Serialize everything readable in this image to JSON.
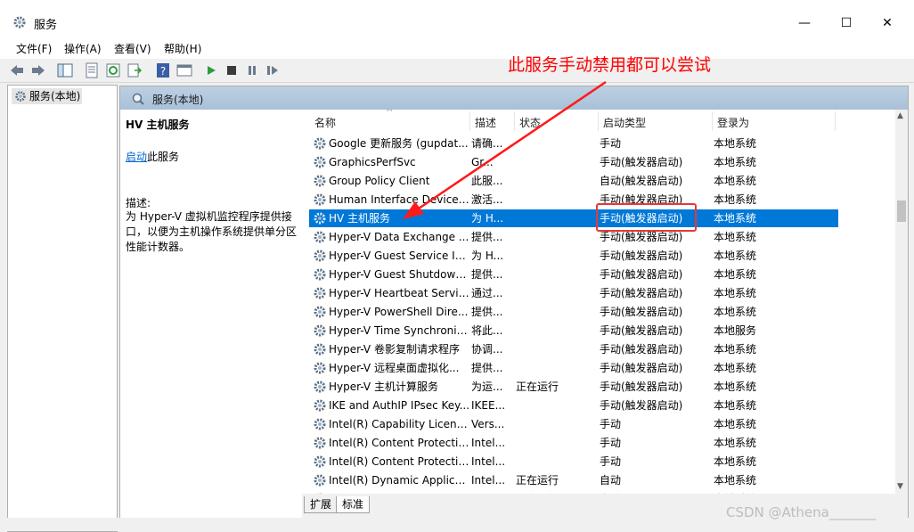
{
  "window": {
    "title": "服务",
    "min": "—",
    "max": "☐",
    "close": "✕"
  },
  "menu": [
    "文件(F)",
    "操作(A)",
    "查看(V)",
    "帮助(H)"
  ],
  "tree": {
    "item": "服务(本地)"
  },
  "main_header": "服务(本地)",
  "detail": {
    "service_name": "HV 主机服务",
    "start_link": "启动",
    "start_suffix": "此服务",
    "desc_label": "描述:",
    "desc_text": "为 Hyper-V 虚拟机监控程序提供接口，以便为主机操作系统提供单分区性能计数器。"
  },
  "columns": {
    "name": "名称",
    "desc": "描述",
    "status": "状态",
    "start_type": "启动类型",
    "logon": "登录为",
    "sort_arrow": "^"
  },
  "rows": [
    {
      "name": "Google 更新服务 (gupdat...",
      "desc": "请确...",
      "status": "",
      "start": "手动",
      "logon": "本地系统"
    },
    {
      "name": "GraphicsPerfSvc",
      "desc": "Gr...",
      "status": "",
      "start": "手动(触发器启动)",
      "logon": "本地系统"
    },
    {
      "name": "Group Policy Client",
      "desc": "此服...",
      "status": "",
      "start": "自动(触发器启动)",
      "logon": "本地系统"
    },
    {
      "name": "Human Interface Device ...",
      "desc": "激活...",
      "status": "",
      "start": "手动(触发器启动)",
      "logon": "本地系统"
    },
    {
      "name": "HV 主机服务",
      "desc": "为 H...",
      "status": "",
      "start": "手动(触发器启动)",
      "logon": "本地系统"
    },
    {
      "name": "Hyper-V Data Exchange ...",
      "desc": "提供...",
      "status": "",
      "start": "手动(触发器启动)",
      "logon": "本地系统"
    },
    {
      "name": "Hyper-V Guest Service In...",
      "desc": "为 H...",
      "status": "",
      "start": "手动(触发器启动)",
      "logon": "本地系统"
    },
    {
      "name": "Hyper-V Guest Shutdown...",
      "desc": "提供...",
      "status": "",
      "start": "手动(触发器启动)",
      "logon": "本地系统"
    },
    {
      "name": "Hyper-V Heartbeat Service",
      "desc": "通过...",
      "status": "",
      "start": "手动(触发器启动)",
      "logon": "本地系统"
    },
    {
      "name": "Hyper-V PowerShell Dire...",
      "desc": "提供...",
      "status": "",
      "start": "手动(触发器启动)",
      "logon": "本地系统"
    },
    {
      "name": "Hyper-V Time Synchroniz...",
      "desc": "将此...",
      "status": "",
      "start": "手动(触发器启动)",
      "logon": "本地服务"
    },
    {
      "name": "Hyper-V 卷影复制请求程序",
      "desc": "协调...",
      "status": "",
      "start": "手动(触发器启动)",
      "logon": "本地系统"
    },
    {
      "name": "Hyper-V 远程桌面虚拟化...",
      "desc": "提供...",
      "status": "",
      "start": "手动(触发器启动)",
      "logon": "本地系统"
    },
    {
      "name": "Hyper-V 主机计算服务",
      "desc": "为运...",
      "status": "正在运行",
      "start": "手动(触发器启动)",
      "logon": "本地系统"
    },
    {
      "name": "IKE and AuthIP IPsec Key...",
      "desc": "IKEE...",
      "status": "",
      "start": "手动(触发器启动)",
      "logon": "本地系统"
    },
    {
      "name": "Intel(R) Capability Licensi...",
      "desc": "Vers...",
      "status": "",
      "start": "手动",
      "logon": "本地系统"
    },
    {
      "name": "Intel(R) Content Protectio...",
      "desc": "Intel...",
      "status": "",
      "start": "手动",
      "logon": "本地系统"
    },
    {
      "name": "Intel(R) Content Protectio...",
      "desc": "Intel...",
      "status": "",
      "start": "手动",
      "logon": "本地系统"
    },
    {
      "name": "Intel(R) Dynamic Applicat...",
      "desc": "Intel...",
      "status": "正在运行",
      "start": "自动",
      "logon": "本地系统"
    },
    {
      "name": "Intel(R) Dynamic Tuning s...",
      "desc": "Intel...",
      "status": "正在运行",
      "start": "自动",
      "logon": "本地系统"
    }
  ],
  "selected_row": 4,
  "tabs": [
    "扩展",
    "标准"
  ],
  "annotation": "此服务手动禁用都可以尝试",
  "watermark": "CSDN @Athena_______",
  "colors": {
    "selection": "#0078d7",
    "annotation": "#ff0000",
    "link": "#0066cc"
  }
}
